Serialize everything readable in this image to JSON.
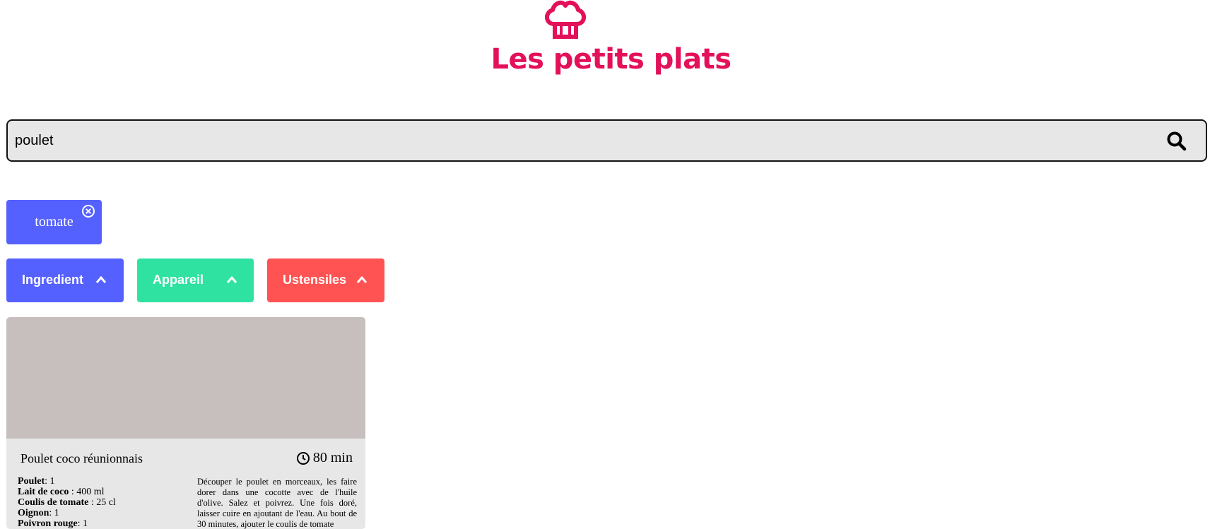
{
  "header": {
    "title": "Les petits plats",
    "logo_icon": "chef-hat-icon",
    "brand_color": "#E3105A"
  },
  "search": {
    "value": "poulet",
    "icon": "search-icon"
  },
  "selected_tags": [
    {
      "label": "tomate",
      "color": "#5561FF",
      "close_icon": "close-circle-icon"
    }
  ],
  "filters": [
    {
      "label": "Ingredient",
      "color": "#5561FF",
      "icon": "chevron-up-icon"
    },
    {
      "label": "Appareil",
      "color": "#2FE2A2",
      "icon": "chevron-up-icon"
    },
    {
      "label": "Ustensiles",
      "color": "#FF5252",
      "icon": "chevron-up-icon"
    }
  ],
  "recipes": [
    {
      "title": "Poulet coco réunionnais",
      "time": "80 min",
      "time_icon": "clock-icon",
      "ingredients": [
        {
          "name": "Poulet",
          "qty": ": 1"
        },
        {
          "name": "Lait de coco",
          "qty": " : 400 ml"
        },
        {
          "name": "Coulis de tomate",
          "qty": " : 25 cl"
        },
        {
          "name": "Oignon",
          "qty": ": 1"
        },
        {
          "name": "Poivron rouge",
          "qty": ": 1"
        }
      ],
      "description": "Découper le poulet en morceaux, les faire dorer dans une cocotte avec de l'huile d'olive. Salez et poivrez. Une fois doré, laisser cuire en ajoutant de l'eau. Au bout de 30 minutes, ajouter le coulis de tomate"
    }
  ]
}
